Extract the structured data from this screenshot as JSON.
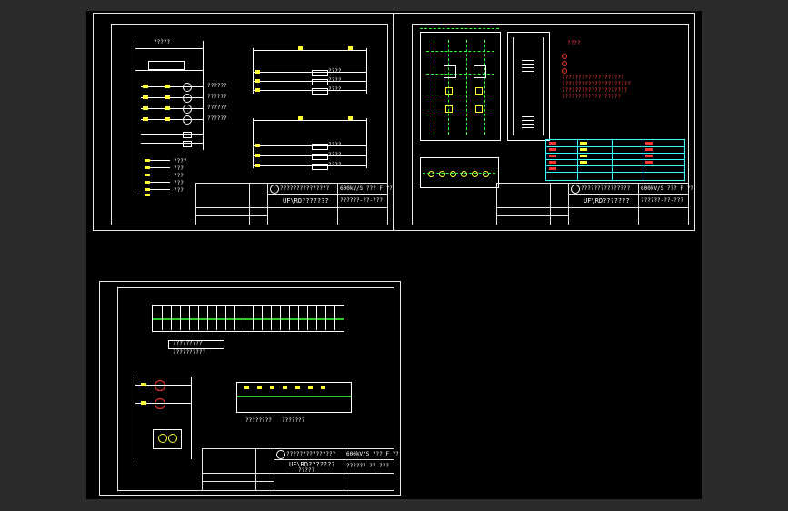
{
  "viewport": {
    "background": "#2b2b2b",
    "canvas_color": "#000000"
  },
  "colors": {
    "frame": "#e8e8e8",
    "green": "#33ff33",
    "yellow": "#ffff33",
    "red": "#ff3333",
    "cyan": "#33ffff"
  },
  "sheets": [
    {
      "id": "sheet-1",
      "title_block": {
        "drawing_title": "UF\\RD???????",
        "scale_label": "600kV/S ??? F ??",
        "company": "???????????????",
        "drawing_no": "??????-??-???"
      },
      "left_labels": [
        "?????",
        "??????",
        "??????",
        "??????",
        "??????",
        "????",
        "???",
        "???",
        "???",
        "???",
        "???",
        "???"
      ],
      "right_labels": [
        "????",
        "????",
        "????",
        "????",
        "????",
        "????"
      ]
    },
    {
      "id": "sheet-2",
      "title_block": {
        "drawing_title": "UF\\RD???????",
        "scale_label": "600kV/S ??? F ??",
        "company": "???????????????",
        "drawing_no": "??????-??-???"
      },
      "legend_red": [
        "????",
        "???????????????????",
        "?????????????????????",
        "????????????????????",
        "??????????????????"
      ],
      "table_rows": 6
    },
    {
      "id": "sheet-3",
      "title_block": {
        "drawing_title": "UF\\RD???????",
        "subtitle": "?????",
        "scale_label": "600kV/S ??? F ??",
        "company": "???????????????",
        "drawing_no": "??????-??-???"
      },
      "terminal_labels": [
        "?????????",
        "??????????"
      ],
      "sub_labels": [
        "????????",
        "???????"
      ]
    }
  ]
}
